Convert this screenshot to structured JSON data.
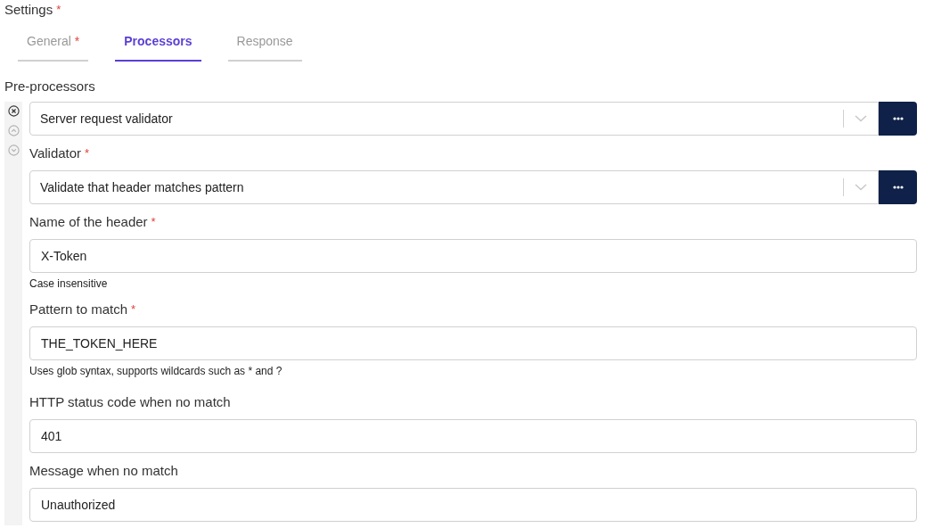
{
  "title": {
    "text": "Settings",
    "mark": "*"
  },
  "tabs": [
    {
      "label": "General",
      "mark": "*",
      "selected": false
    },
    {
      "label": "Processors",
      "selected": true
    },
    {
      "label": "Response",
      "selected": false
    }
  ],
  "section": {
    "title": "Pre-processors"
  },
  "processor": {
    "value": "Server request validator",
    "fields": [
      {
        "kind": "select",
        "label": "Validator",
        "mark": "*",
        "value": "Validate that header matches pattern"
      },
      {
        "kind": "text",
        "label": "Name of the header",
        "mark": "*",
        "value": "X-Token",
        "help": "Case insensitive"
      },
      {
        "kind": "text",
        "label": "Pattern to match",
        "mark": "*",
        "value": "THE_TOKEN_HERE",
        "help": "Uses glob syntax, supports wildcards such as * and ?"
      },
      {
        "kind": "text",
        "label": "HTTP status code when no match",
        "value": "401"
      },
      {
        "kind": "text",
        "label": "Message when no match",
        "value": "Unauthorized"
      }
    ]
  }
}
